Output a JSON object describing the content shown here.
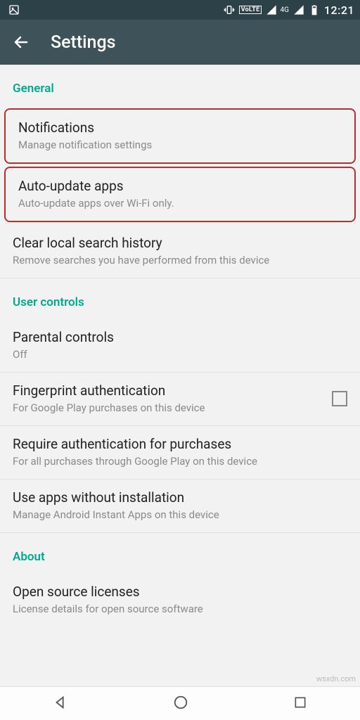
{
  "statusbar": {
    "volte": "VoLTE",
    "network_label": "4G",
    "time": "12:21"
  },
  "appbar": {
    "title": "Settings"
  },
  "sections": {
    "general": {
      "header": "General",
      "notifications": {
        "title": "Notifications",
        "subtitle": "Manage notification settings"
      },
      "auto_update": {
        "title": "Auto-update apps",
        "subtitle": "Auto-update apps over Wi-Fi only."
      },
      "clear_history": {
        "title": "Clear local search history",
        "subtitle": "Remove searches you have performed from this device"
      }
    },
    "user_controls": {
      "header": "User controls",
      "parental": {
        "title": "Parental controls",
        "subtitle": "Off"
      },
      "fingerprint": {
        "title": "Fingerprint authentication",
        "subtitle": "For Google Play purchases on this device",
        "checked": false
      },
      "require_auth": {
        "title": "Require authentication for purchases",
        "subtitle": "For all purchases through Google Play on this device"
      },
      "instant_apps": {
        "title": "Use apps without installation",
        "subtitle": "Manage Android Instant Apps on this device"
      }
    },
    "about": {
      "header": "About",
      "oss": {
        "title": "Open source licenses",
        "subtitle": "License details for open source software"
      }
    }
  },
  "watermark": "wsxdn.com"
}
